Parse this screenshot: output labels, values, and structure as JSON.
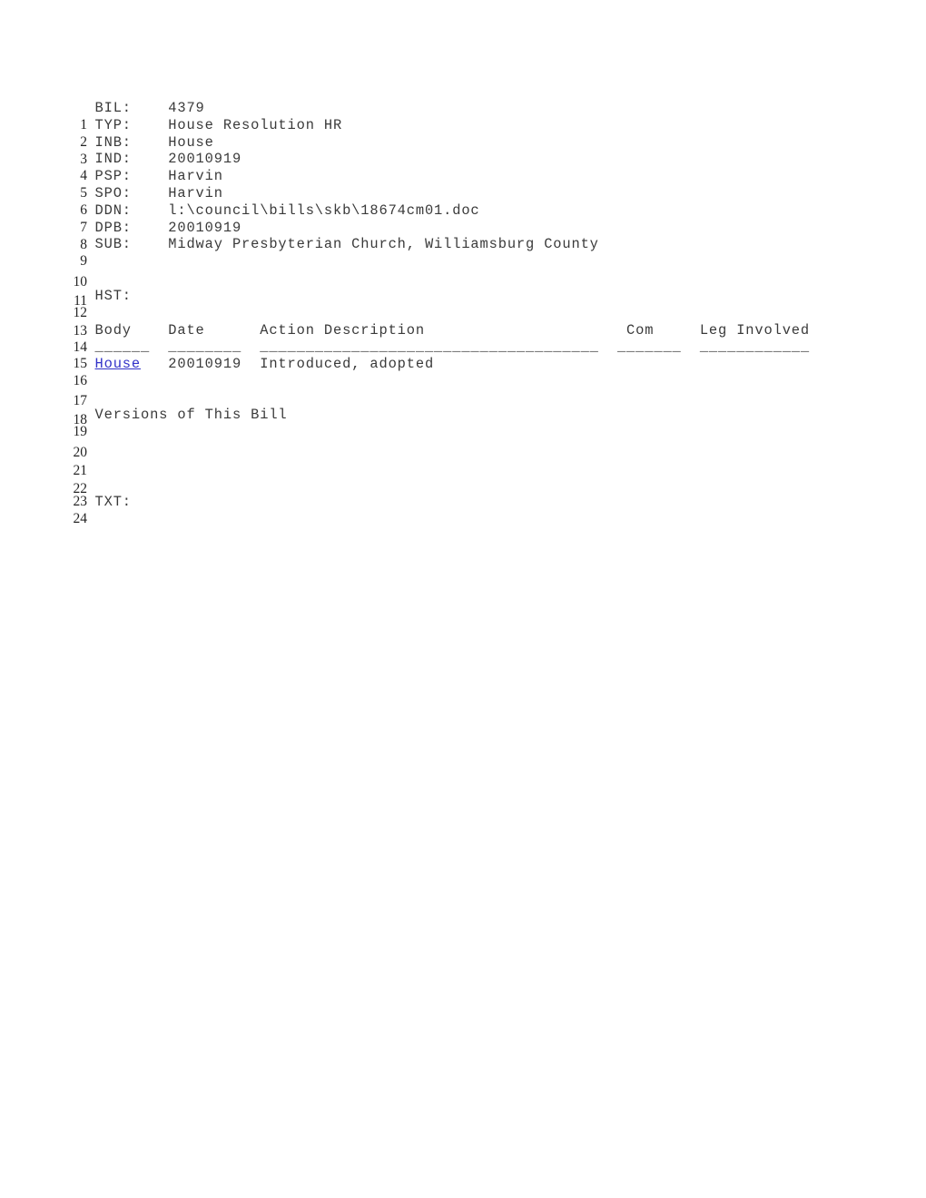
{
  "document": {
    "kind": "legislative-bill-record",
    "link_color": "#3232c8",
    "text_color": "#3a3a3a",
    "lines": [
      {
        "n": "1",
        "text": "BIL:    4379"
      },
      {
        "n": "2",
        "text": "TYP:    House Resolution HR"
      },
      {
        "n": "3",
        "text": "INB:    House"
      },
      {
        "n": "4",
        "text": "IND:    20010919"
      },
      {
        "n": "5",
        "text": "PSP:    Harvin"
      },
      {
        "n": "6",
        "text": "SPO:    Harvin"
      },
      {
        "n": "7",
        "text": "DDN:    l:\\council\\bills\\skb\\18674cm01.doc"
      },
      {
        "n": "8",
        "text": "DPB:    20010919"
      },
      {
        "n": "9",
        "text": "SUB:    Midway Presbyterian Church, Williamsburg County"
      },
      {
        "n": "10",
        "text": ""
      },
      {
        "n": "11",
        "text": ""
      },
      {
        "n": "12",
        "text": "HST:"
      },
      {
        "n": "13",
        "text": ""
      },
      {
        "n": "14",
        "text": "Body    Date      Action Description                      Com     Leg Involved"
      },
      {
        "n": "15",
        "text": "______  ________  _____________________________________  _______  ____________"
      },
      {
        "n": "16",
        "text": "",
        "link": "House",
        "after_link": "   20010919  Introduced, adopted"
      },
      {
        "n": "17",
        "text": ""
      },
      {
        "n": "18",
        "text": ""
      },
      {
        "n": "19",
        "text": "Versions of This Bill"
      },
      {
        "n": "20",
        "text": ""
      },
      {
        "n": "21",
        "text": ""
      },
      {
        "n": "22",
        "text": ""
      },
      {
        "n": "23",
        "text": ""
      },
      {
        "n": "24",
        "text": "TXT:"
      }
    ],
    "fields": {
      "BIL": "4379",
      "TYP": "House Resolution HR",
      "INB": "House",
      "IND": "20010919",
      "PSP": "Harvin",
      "SPO": "Harvin",
      "DDN": "l:\\council\\bills\\skb\\18674cm01.doc",
      "DPB": "20010919",
      "SUB": "Midway Presbyterian Church, Williamsburg County",
      "HST": "",
      "TXT": ""
    },
    "history_table": {
      "headers": [
        "Body",
        "Date",
        "Action Description",
        "Com",
        "Leg Involved"
      ],
      "rows": [
        {
          "body": "House",
          "date": "20010919",
          "action": "Introduced, adopted",
          "com": "",
          "leg_involved": ""
        }
      ]
    },
    "versions_heading": "Versions of This Bill"
  }
}
